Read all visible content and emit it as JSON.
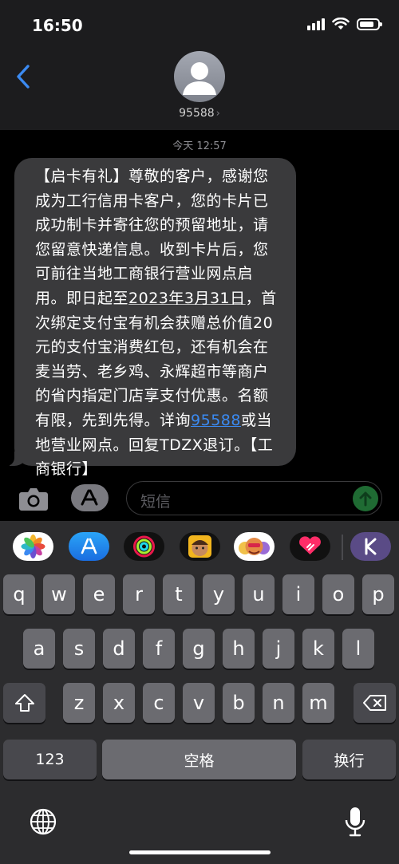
{
  "status_bar": {
    "time": "16:50",
    "battery_level": 0.8
  },
  "header": {
    "contact_name": "95588",
    "chevron": "›"
  },
  "thread": {
    "timestamp": "今天 12:57",
    "message": {
      "part1": "【启卡有礼】尊敬的客户，感谢您成为工行信用卡客户，您的卡片已成功制卡并寄往您的预留地址，请您留意快递信息。收到卡片后，您可前往当地工商银行营业网点启用。即日起至",
      "date_link": "2023年3月31日",
      "part2": "，首次绑定支付宝有机会获赠总价值20元的支付宝消费红包，还有机会在麦当劳、老乡鸡、永辉超市等商户的省内指定门店享支付优惠。名额有限，先到先得。详询",
      "phone_link": "95588",
      "part3": "或当地营业网点。回复TDZX退订。【工商银行】"
    }
  },
  "composer": {
    "placeholder": "短信"
  },
  "keyboard": {
    "row1": [
      "q",
      "w",
      "e",
      "r",
      "t",
      "y",
      "u",
      "i",
      "o",
      "p"
    ],
    "row2": [
      "a",
      "s",
      "d",
      "f",
      "g",
      "h",
      "j",
      "k",
      "l"
    ],
    "row3": [
      "z",
      "x",
      "c",
      "v",
      "b",
      "n",
      "m"
    ],
    "numbers_key": "123",
    "space_key": "空格",
    "return_key": "换行"
  },
  "icons": {
    "back": "chevron-left-icon",
    "camera": "camera-icon",
    "apps": "app-store-icon",
    "send": "arrow-up-icon",
    "shift": "shift-icon",
    "delete": "delete-icon",
    "globe": "globe-icon",
    "mic": "microphone-icon"
  },
  "colors": {
    "accent": "#3b8af1",
    "bubble": "#3a3a3c",
    "keyboard_bg": "#2c2c2e",
    "key": "#6b6b70"
  }
}
